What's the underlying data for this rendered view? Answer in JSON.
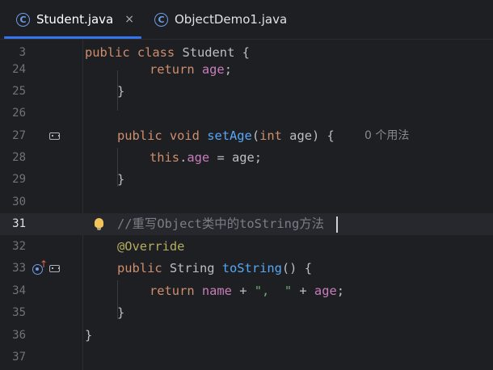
{
  "tabs": [
    {
      "label": "Student.java",
      "icon": "class-icon",
      "active": true,
      "close": "×"
    },
    {
      "label": "ObjectDemo1.java",
      "icon": "class-run-icon",
      "active": false
    }
  ],
  "colors": {
    "background": "#1e1f22",
    "keyword": "#cf8e6d",
    "field": "#c77dbb",
    "method": "#56a8f5",
    "string": "#6aab73",
    "annotation": "#b3ae60",
    "comment": "#7a7e85",
    "accent": "#3574f0"
  },
  "lines": {
    "l3": {
      "num": "3",
      "t1": "public class ",
      "t2": "Student {"
    },
    "l24": {
      "num": "24",
      "t1": "return ",
      "t2": "age",
      "t3": ";"
    },
    "l25": {
      "num": "25",
      "t1": "}"
    },
    "l26": {
      "num": "26"
    },
    "l27": {
      "num": "27",
      "t1": "public void ",
      "t2": "setAge",
      "t3": "(",
      "t4": "int ",
      "t5": "age) {",
      "hint": "0 个用法"
    },
    "l28": {
      "num": "28",
      "t1": "this",
      "t2": ".",
      "t3": "age",
      "t4": " = age;"
    },
    "l29": {
      "num": "29",
      "t1": "}"
    },
    "l30": {
      "num": "30"
    },
    "l31": {
      "num": "31",
      "t1": "//重写Object类中的toString方法"
    },
    "l32": {
      "num": "32",
      "t1": "@Override"
    },
    "l33": {
      "num": "33",
      "t1": "public ",
      "t2": "String ",
      "t3": "toString",
      "t4": "() {"
    },
    "l34": {
      "num": "34",
      "t1": "return ",
      "t2": "name",
      "t3": " + ",
      "t4": "\",  \"",
      "t5": " + ",
      "t6": "age",
      "t7": ";"
    },
    "l35": {
      "num": "35",
      "t1": "}"
    },
    "l36": {
      "num": "36",
      "t1": "}"
    },
    "l37": {
      "num": "37"
    }
  }
}
